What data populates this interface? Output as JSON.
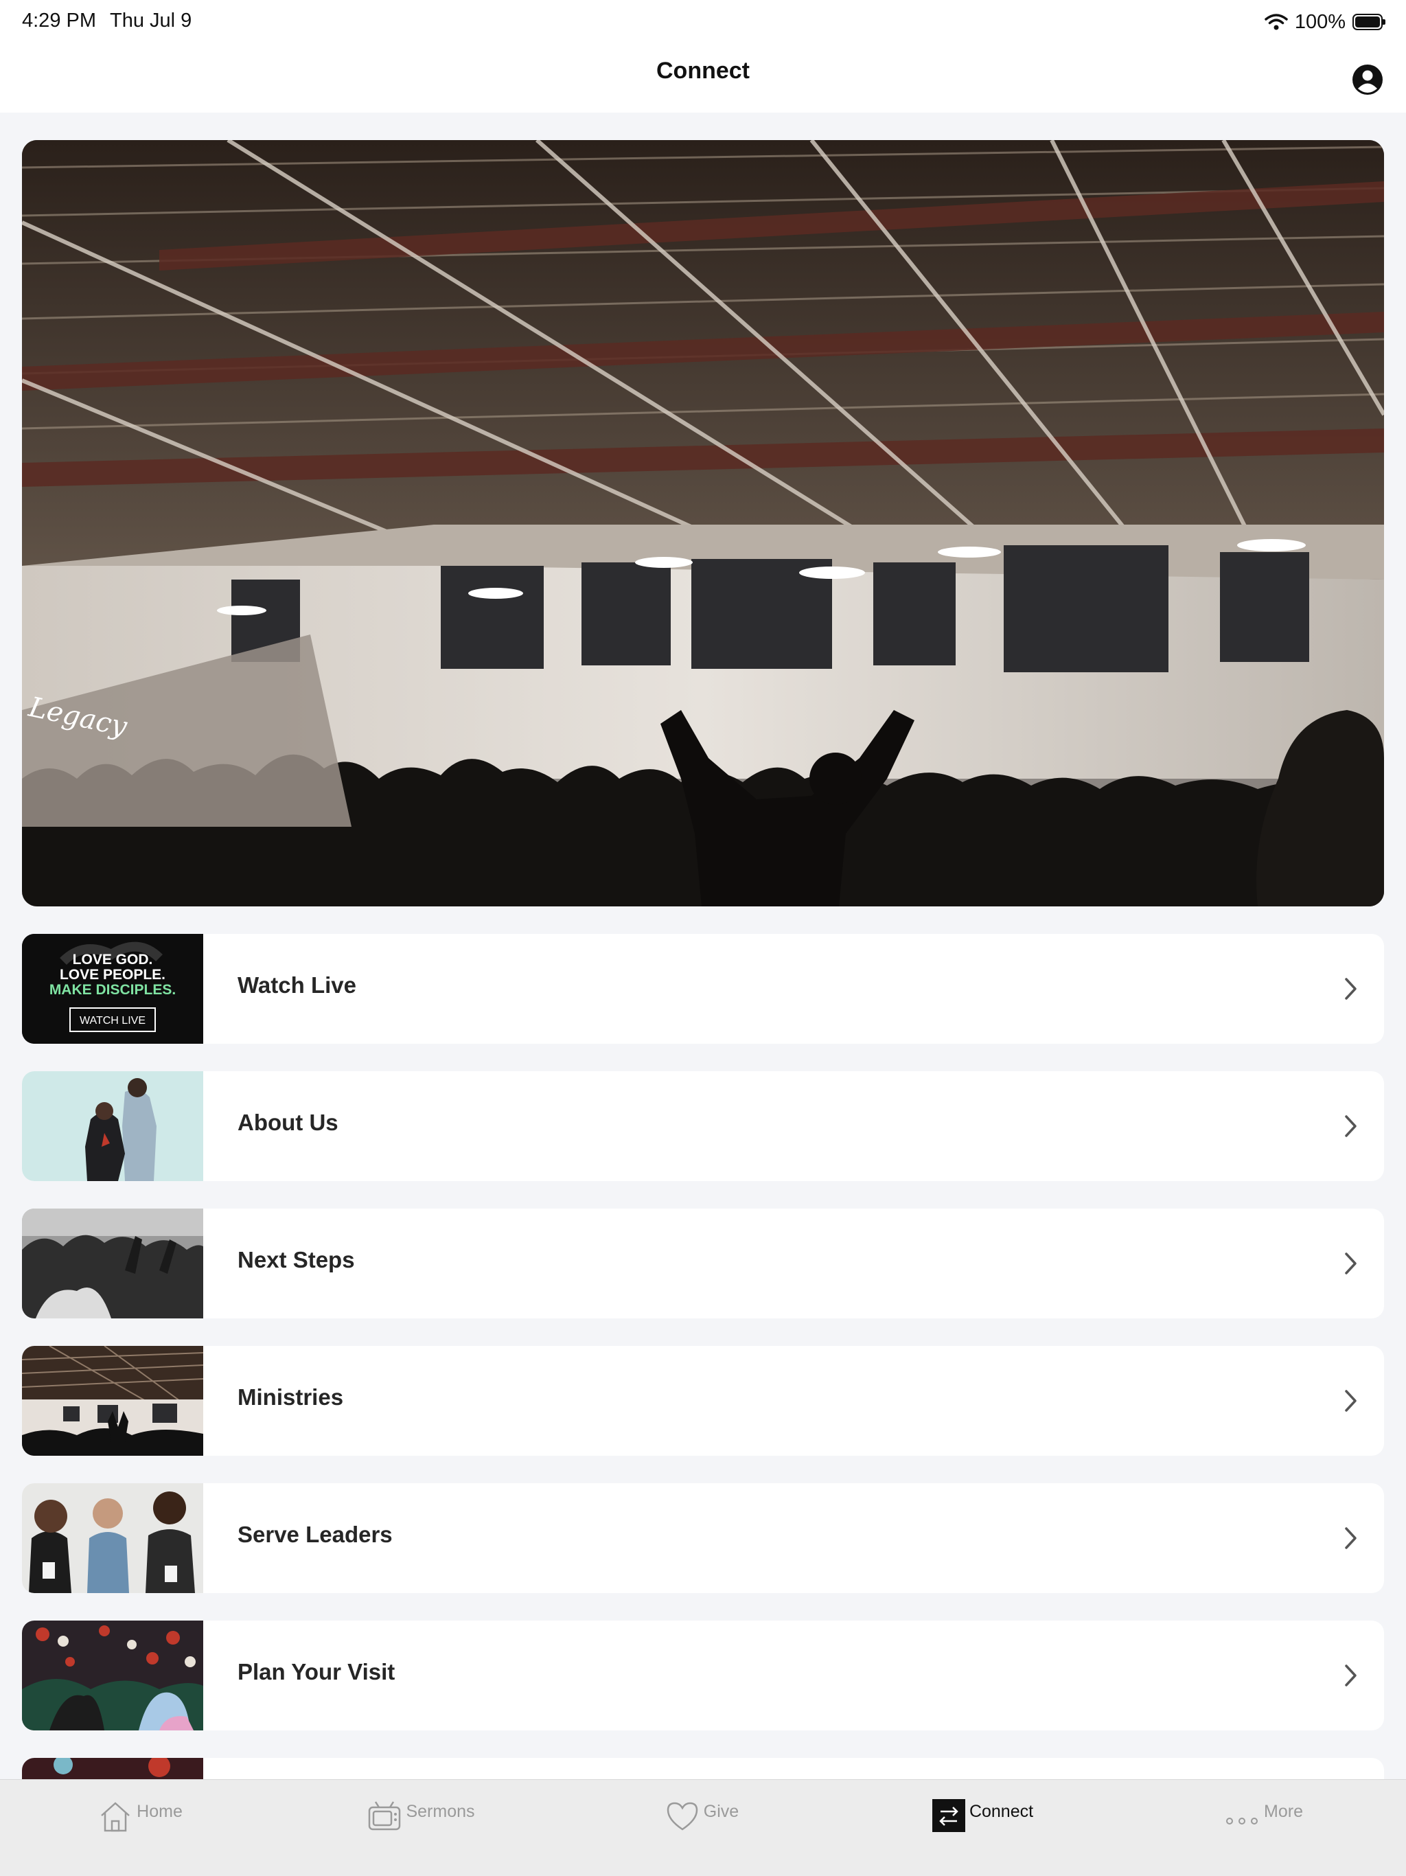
{
  "status_bar": {
    "time": "4:29 PM",
    "date": "Thu Jul 9",
    "battery": "100%",
    "icons": [
      "wifi-icon",
      "battery-icon"
    ]
  },
  "nav": {
    "title": "Connect",
    "profile_icon": "person-circle-icon"
  },
  "hero": {
    "wall_sign": "Legacy"
  },
  "items": [
    {
      "label": "Watch Live",
      "thumb_lines": [
        "LOVE GOD.",
        "LOVE PEOPLE.",
        "MAKE DISCIPLES."
      ],
      "thumb_button": "WATCH LIVE"
    },
    {
      "label": "About Us"
    },
    {
      "label": "Next Steps"
    },
    {
      "label": "Ministries"
    },
    {
      "label": "Serve Leaders"
    },
    {
      "label": "Plan Your Visit"
    }
  ],
  "tabs": [
    {
      "label": "Home",
      "icon": "home-icon"
    },
    {
      "label": "Sermons",
      "icon": "tv-icon"
    },
    {
      "label": "Give",
      "icon": "heart-icon"
    },
    {
      "label": "Connect",
      "icon": "connect-arrows-icon",
      "active": true
    },
    {
      "label": "More",
      "icon": "more-dots-icon"
    }
  ],
  "colors": {
    "accent_green": "#7fe3a2",
    "active_tab": "#111111",
    "inactive_tab": "#9a9a9a"
  }
}
